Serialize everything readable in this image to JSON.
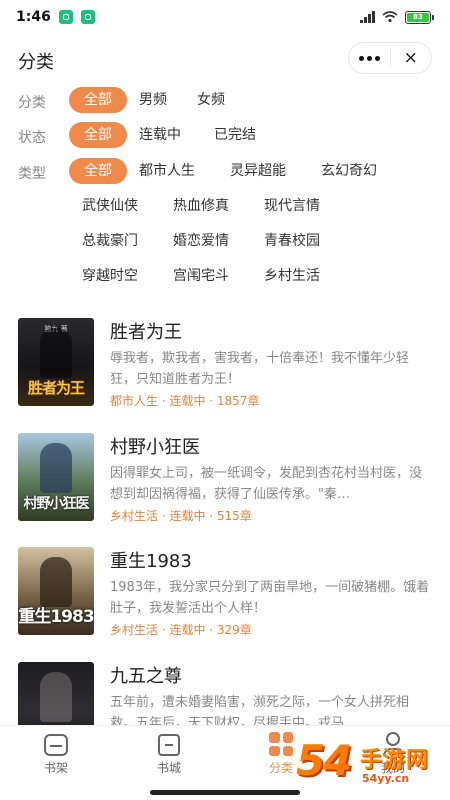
{
  "status_bar": {
    "time": "1:46",
    "battery": "83"
  },
  "header": {
    "title": "分类",
    "more_icon": "more-dots-icon",
    "close_label": "×"
  },
  "filters": {
    "category": {
      "label": "分类",
      "options": [
        "全部",
        "男频",
        "女频"
      ],
      "selected": "全部"
    },
    "status": {
      "label": "状态",
      "options": [
        "全部",
        "连载中",
        "已完结"
      ],
      "selected": "全部"
    },
    "genre": {
      "label": "类型",
      "options": [
        "全部",
        "都市人生",
        "灵异超能",
        "玄幻奇幻",
        "武侠仙侠",
        "热血修真",
        "现代言情",
        "总裁豪门",
        "婚恋爱情",
        "青春校园",
        "穿越时空",
        "宫闱宅斗",
        "乡村生活"
      ],
      "selected": "全部"
    }
  },
  "books": [
    {
      "title": "胜者为王",
      "desc": "辱我者，欺我者，害我者，十倍奉还！我不懂年少轻狂，只知道胜者为王！",
      "meta": "都市人生 · 连载中 · 1857章",
      "cover_text": "胜者为王",
      "cover_small": "独九 著"
    },
    {
      "title": "村野小狂医",
      "desc": "因得罪女上司，被一纸调令，发配到杏花村当村医，没想到却因祸得福，获得了仙医传承。\"秦…",
      "meta": "乡村生活 · 连载中 · 515章",
      "cover_text": "村野小狂医",
      "cover_small": ""
    },
    {
      "title": "重生1983",
      "desc": "1983年，我分家只分到了两亩旱地，一间破猪棚。饿着肚子，我发誓活出个人样！",
      "meta": "乡村生活 · 连载中 · 329章",
      "cover_text": "重生1983",
      "cover_small": ""
    },
    {
      "title": "九五之尊",
      "desc": "五年前，遭未婚妻陷害，濒死之际，一个女人拼死相救。五年后，天下财权，尽握手中。戎马…",
      "meta": "",
      "cover_text": "",
      "cover_small": ""
    }
  ],
  "tabbar": {
    "tabs": [
      {
        "label": "书架",
        "icon": "bookshelf-icon"
      },
      {
        "label": "书城",
        "icon": "bookstore-icon"
      },
      {
        "label": "分类",
        "icon": "category-grid-icon",
        "active": true
      },
      {
        "label": "我的",
        "icon": "profile-icon"
      }
    ]
  },
  "watermark": {
    "number": "54",
    "text": "手游网",
    "url": "54yy.cn"
  },
  "colors": {
    "accent": "#f08a4b",
    "meta": "#e0843c",
    "battery": "#3cc14a"
  }
}
